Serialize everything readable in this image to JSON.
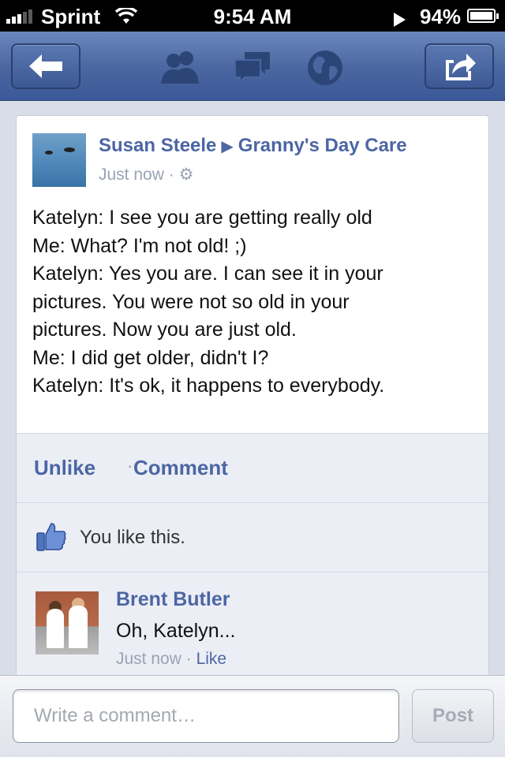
{
  "status_bar": {
    "carrier": "Sprint",
    "time": "9:54 AM",
    "battery": "94%",
    "battery_level": 0.94
  },
  "nav": {
    "icons": [
      "back-arrow-icon",
      "friends-icon",
      "messages-icon",
      "globe-icon",
      "share-icon"
    ]
  },
  "post": {
    "author": "Susan Steele",
    "target": "Granny's Day Care",
    "timestamp": "Just now",
    "separator": "·",
    "lines": [
      "Katelyn:  I see you are getting really old",
      "Me:  What?  I'm not old!  ;)",
      "Katelyn:  Yes you are.  I can see it in your",
      "pictures.  You were not so old in your",
      "pictures. Now you are just old.",
      "Me:  I did get older, didn't I?",
      "Katelyn:  It's ok, it happens to everybody."
    ],
    "actions": {
      "unlike": "Unlike",
      "separator": "·",
      "comment": "Comment"
    },
    "likes_text": "You like this."
  },
  "comment": {
    "author": "Brent Butler",
    "text": "Oh, Katelyn...",
    "timestamp": "Just now",
    "separator": "·",
    "like": "Like"
  },
  "composer": {
    "placeholder": "Write a comment…",
    "post_label": "Post"
  },
  "colors": {
    "brand": "#3b5998",
    "link": "#4c66a4"
  }
}
